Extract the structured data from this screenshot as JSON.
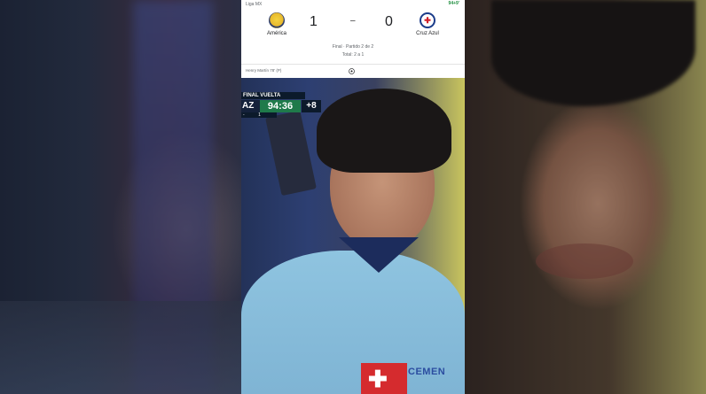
{
  "scorecard": {
    "league": "Liga MX",
    "live_badge": "94+9'",
    "home": {
      "name": "América",
      "score": "1"
    },
    "separator": "–",
    "away": {
      "name": "Cruz Azul",
      "score": "0"
    },
    "status_line1": "Final · Partido 2 de 2",
    "status_line2": "Total: 2 a 1",
    "scorer": "Henry Martín 78' (P)",
    "icons": {
      "home_crest": "america-crest-icon",
      "away_crest": "cruz-azul-crest-icon",
      "ball": "soccer-ball-icon"
    },
    "colors": {
      "live": "#1e8e3e"
    }
  },
  "broadcast": {
    "stage": "FINAL VUELTA",
    "team_abbr": "AZ",
    "clock": "94:36",
    "added_time": "+8",
    "sub_left": "-",
    "sub_right": "1",
    "colors": {
      "clock_bg": "#1f7a4a",
      "panel_bg": "#0c1a2b"
    }
  },
  "jersey": {
    "sponsor_text": "CEMEN"
  }
}
